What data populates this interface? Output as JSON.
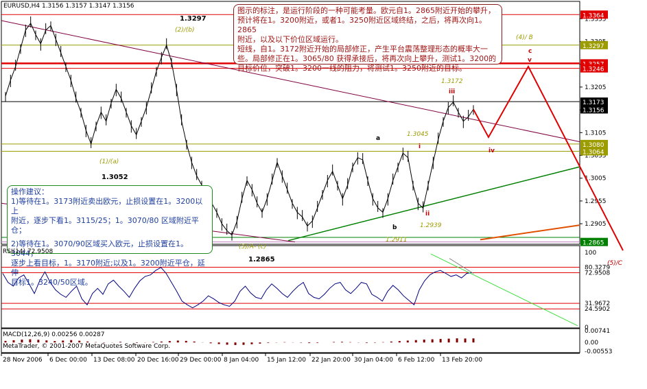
{
  "symbol_header": "EURUSD,H4  1.3156 1.3157 1.3147 1.3156",
  "analysis_note": [
    "图示的标注，是运行阶段的一种可能考量。欧元自1。2865附近开始的攀升，",
    "预计将在1。3200附近，或者1。3250附近区域终结，之后，将再次向1。2865",
    "附近，以及以下价位区域运行。",
    "短线，自1。3172附近开始的局部修正，产生平台震荡整理形态的概率大一",
    "些。局部修正在1。3065/80 获得承接后，将再次向上攀升，测试1。3200的",
    "目标价位，突破1。3200一线的阻力，将测试1。3250附近的目标。"
  ],
  "advice": {
    "title": "操作建议：",
    "lines": [
      "1)等待在1。3173附近卖出欧元，止损设置在1。3200以上",
      "附近，逐步下看1。3115/25；1。3070/80 区域附近平仓；",
      "",
      "2)等待在1。3070/90区域买入欧元，止损设置在1。3044，",
      "逐步上看目标，1。3170附近;以及1。3200附近平仓，延伸",
      "目标1。3240/50区域。"
    ]
  },
  "wave_labels": {
    "w1": "(1)/(a)",
    "w2": "(2)/(b)",
    "w3": "(3)/A- (c)",
    "w4": "(4)/ B",
    "w5": "(5)/C",
    "a": "a",
    "b": "b",
    "c": "c",
    "i": "i",
    "ii": "ii",
    "iii": "iii",
    "iv": "iv",
    "v": "v"
  },
  "level_labels": {
    "p13297": "1.3297",
    "p13052": "1.3052",
    "p13045": "1.3045",
    "p13172": "1.3172",
    "p12939": "1.2939",
    "p12911": "1.2911",
    "p12865": "1.2865"
  },
  "rsi_label": "RSI(14) 72.9508",
  "macd_label": "MACD(12,26,9) 0.00256 0.00287",
  "copyright": "MetaTrader, © 2001-2007 MetaQuotes Software Corp.",
  "colors": {
    "price": "#000000",
    "rsi": "#000080",
    "macd_hist": "#800000",
    "resistance": "#e00000",
    "fib": "#9c9c00",
    "trend_up": "#008000",
    "trend_down": "#800040",
    "projection": "#e00000",
    "orange_line": "#e05000"
  },
  "chart_data": [
    {
      "type": "line",
      "title": "EURUSD,H4",
      "x_tick_labels": [
        "28 Nov 2006",
        "6 Dec 00:00",
        "13 Dec 08:00",
        "20 Dec 16:00",
        "29 Dec 00:00",
        "8 Jan 04:00",
        "15 Jan 12:00",
        "22 Jan 20:00",
        "30 Jan 04:00",
        "6 Feb 12:00",
        "13 Feb 20:00"
      ],
      "y_tick_labels": [
        "1.3355",
        "1.3305",
        "1.3255",
        "1.3205",
        "1.3155",
        "1.3105",
        "1.3055",
        "1.3005",
        "1.2955",
        "1.2905"
      ],
      "ylim": [
        1.286,
        1.3378
      ],
      "price_boxes": [
        {
          "value": 1.3364,
          "text": "1.3364",
          "color": "#e00000"
        },
        {
          "value": 1.3297,
          "text": "1.3297",
          "color": "#9c9c00"
        },
        {
          "value": 1.3257,
          "text": "1.3257",
          "color": "#e00000"
        },
        {
          "value": 1.3246,
          "text": "1.3246",
          "color": "#e00000"
        },
        {
          "value": 1.3173,
          "text": "1.3173",
          "color": "#000000"
        },
        {
          "value": 1.3156,
          "text": "1.3156",
          "color": "#000000"
        },
        {
          "value": 1.308,
          "text": "1.3080",
          "color": "#9c9c00"
        },
        {
          "value": 1.3064,
          "text": "1.3064",
          "color": "#9c9c00"
        },
        {
          "value": 1.2865,
          "text": "1.2865",
          "color": "#008000"
        }
      ],
      "close": [
        1.3185,
        1.322,
        1.325,
        1.329,
        1.333,
        1.3345,
        1.332,
        1.33,
        1.333,
        1.334,
        1.331,
        1.328,
        1.325,
        1.322,
        1.318,
        1.315,
        1.311,
        1.308,
        1.312,
        1.315,
        1.313,
        1.317,
        1.32,
        1.318,
        1.315,
        1.312,
        1.31,
        1.313,
        1.316,
        1.32,
        1.324,
        1.327,
        1.3297,
        1.326,
        1.32,
        1.313,
        1.308,
        1.304,
        1.301,
        1.299,
        1.297,
        1.295,
        1.293,
        1.2905,
        1.289,
        1.288,
        1.291,
        1.296,
        1.3,
        1.298,
        1.295,
        1.293,
        1.296,
        1.3,
        1.304,
        1.301,
        1.298,
        1.295,
        1.293,
        1.292,
        1.29,
        1.2911,
        1.294,
        1.297,
        1.3,
        1.302,
        1.299,
        1.296,
        1.299,
        1.303,
        1.305,
        1.3045,
        1.3,
        1.296,
        1.294,
        1.293,
        1.296,
        1.3,
        1.303,
        1.306,
        1.305,
        1.299,
        1.295,
        1.2939,
        1.299,
        1.304,
        1.309,
        1.313,
        1.316,
        1.3172,
        1.315,
        1.313,
        1.314,
        1.3156
      ]
    },
    {
      "type": "line",
      "title": "RSI(14)",
      "y_tick_labels": [
        "100",
        "80.3279",
        "72.9508",
        "31.9672",
        "24.5902",
        "0"
      ],
      "ylim": [
        0,
        100
      ],
      "values": [
        72,
        60,
        55,
        66,
        70,
        58,
        45,
        62,
        74,
        60,
        50,
        44,
        40,
        48,
        55,
        38,
        30,
        45,
        52,
        44,
        58,
        63,
        55,
        48,
        40,
        52,
        62,
        68,
        70,
        76,
        80,
        72,
        60,
        48,
        35,
        30,
        26,
        30,
        35,
        42,
        38,
        33,
        30,
        28,
        35,
        48,
        55,
        46,
        40,
        38,
        50,
        58,
        52,
        45,
        40,
        48,
        55,
        60,
        45,
        40,
        38,
        44,
        52,
        58,
        60,
        50,
        45,
        52,
        60,
        58,
        44,
        40,
        35,
        48,
        56,
        50,
        42,
        36,
        30,
        50,
        62,
        70,
        74,
        76,
        72,
        68,
        70,
        66,
        72,
        73
      ]
    },
    {
      "type": "bar",
      "title": "MACD(12,26,9)",
      "y_tick_labels": [
        "0.00741",
        "0.00",
        "-0.00553"
      ],
      "ylim": [
        -0.00553,
        0.00741
      ],
      "values": [
        0.001,
        0.0014,
        0.0018,
        0.002,
        0.0017,
        0.0013,
        0.0009,
        0.0012,
        0.0015,
        0.0011,
        0.0006,
        0.0002,
        -0.0002,
        0.0001,
        0.0004,
        0.0,
        -0.0003,
        -0.0001,
        0.0003,
        0.0006,
        0.0009,
        0.0012,
        0.001,
        0.0006,
        0.0001,
        -0.0005,
        -0.001,
        -0.0014,
        -0.0016,
        -0.0015,
        -0.0011,
        -0.0007,
        -0.0003,
        -0.0001,
        0.0002,
        0.0001,
        -0.0002,
        -0.0004,
        -0.0003,
        0.0,
        0.0003,
        0.0004,
        0.0002,
        -0.0001,
        -0.0003,
        -0.0002,
        0.0002,
        0.0006,
        0.0009,
        0.0012,
        0.0015,
        0.0018,
        0.002,
        0.0022,
        0.0024,
        0.0026,
        0.0025,
        0.00256
      ]
    }
  ]
}
